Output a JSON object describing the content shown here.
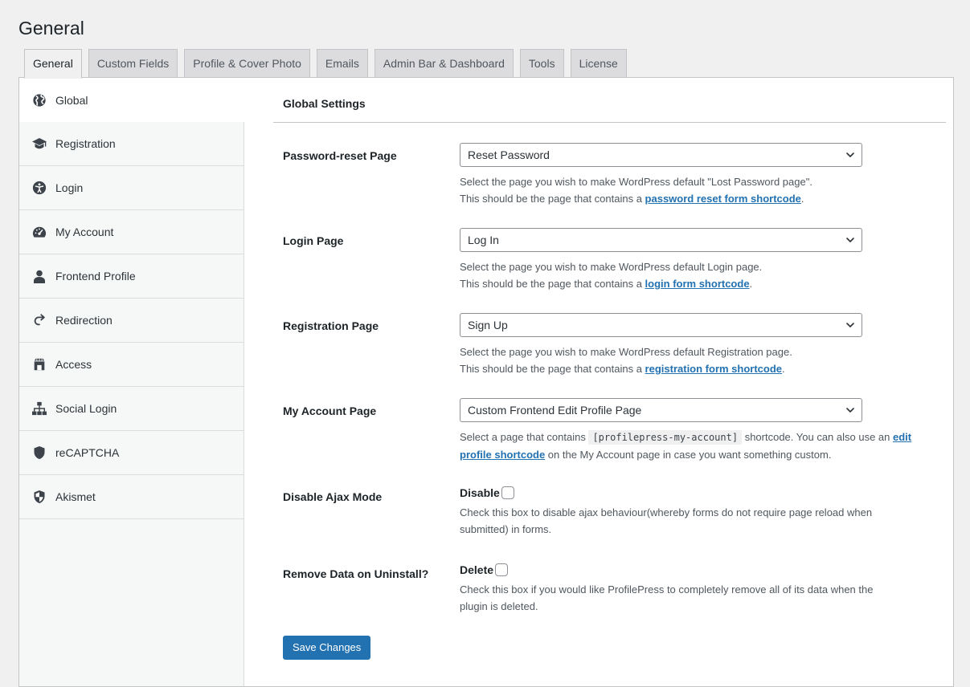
{
  "page": {
    "title": "General"
  },
  "tabs": [
    {
      "label": "General",
      "active": true
    },
    {
      "label": "Custom Fields"
    },
    {
      "label": "Profile & Cover Photo"
    },
    {
      "label": "Emails"
    },
    {
      "label": "Admin Bar & Dashboard"
    },
    {
      "label": "Tools"
    },
    {
      "label": "License"
    }
  ],
  "sidebar": {
    "items": [
      {
        "label": "Global",
        "icon": "globe-icon",
        "active": true
      },
      {
        "label": "Registration",
        "icon": "graduation-cap-icon"
      },
      {
        "label": "Login",
        "icon": "universal-access-icon"
      },
      {
        "label": "My Account",
        "icon": "dashboard-gauge-icon"
      },
      {
        "label": "Frontend Profile",
        "icon": "user-icon"
      },
      {
        "label": "Redirection",
        "icon": "redo-arrow-icon"
      },
      {
        "label": "Access",
        "icon": "store-icon"
      },
      {
        "label": "Social Login",
        "icon": "network-icon"
      },
      {
        "label": "reCAPTCHA",
        "icon": "shield-icon"
      },
      {
        "label": "Akismet",
        "icon": "shield-alt-icon"
      }
    ]
  },
  "main": {
    "section_title": "Global Settings",
    "password_reset": {
      "label": "Password-reset Page",
      "selected": "Reset Password",
      "desc_line1": "Select the page you wish to make WordPress default \"Lost Password page\".",
      "desc_line2_prefix": "This should be the page that contains a ",
      "desc_link": "password reset form shortcode",
      "desc_suffix": "."
    },
    "login": {
      "label": "Login Page",
      "selected": "Log In",
      "desc_line1": "Select the page you wish to make WordPress default Login page.",
      "desc_line2_prefix": "This should be the page that contains a ",
      "desc_link": "login form shortcode",
      "desc_suffix": "."
    },
    "registration": {
      "label": "Registration Page",
      "selected": "Sign Up",
      "desc_line1": "Select the page you wish to make WordPress default Registration page.",
      "desc_line2_prefix": "This should be the page that contains a ",
      "desc_link": "registration form shortcode",
      "desc_suffix": "."
    },
    "my_account": {
      "label": "My Account Page",
      "selected": "Custom Frontend Edit Profile Page",
      "desc_prefix": "Select a page that contains ",
      "desc_code": "[profilepress-my-account]",
      "desc_middle": " shortcode. You can also use an ",
      "desc_link_part1": "edit",
      "desc_link_part2": "profile shortcode",
      "desc_suffix": " on the My Account page in case you want something custom."
    },
    "disable_ajax": {
      "label": "Disable Ajax Mode",
      "checkbox_label": "Disable",
      "checked": false,
      "desc_line1": "Check this box to disable ajax behaviour(whereby forms do not require page reload when",
      "desc_line2": "submitted) in forms."
    },
    "remove_data": {
      "label": "Remove Data on Uninstall?",
      "checkbox_label": "Delete",
      "checked": false,
      "desc_line1": "Check this box if you would like ProfilePress to completely remove all of its data when the",
      "desc_line2": "plugin is deleted."
    },
    "save_label": "Save Changes"
  },
  "colors": {
    "accent": "#2271b1",
    "background": "#f0f0f1",
    "panel": "#ffffff",
    "sidebar": "#f6f7f7",
    "border": "#c3c4c7"
  }
}
